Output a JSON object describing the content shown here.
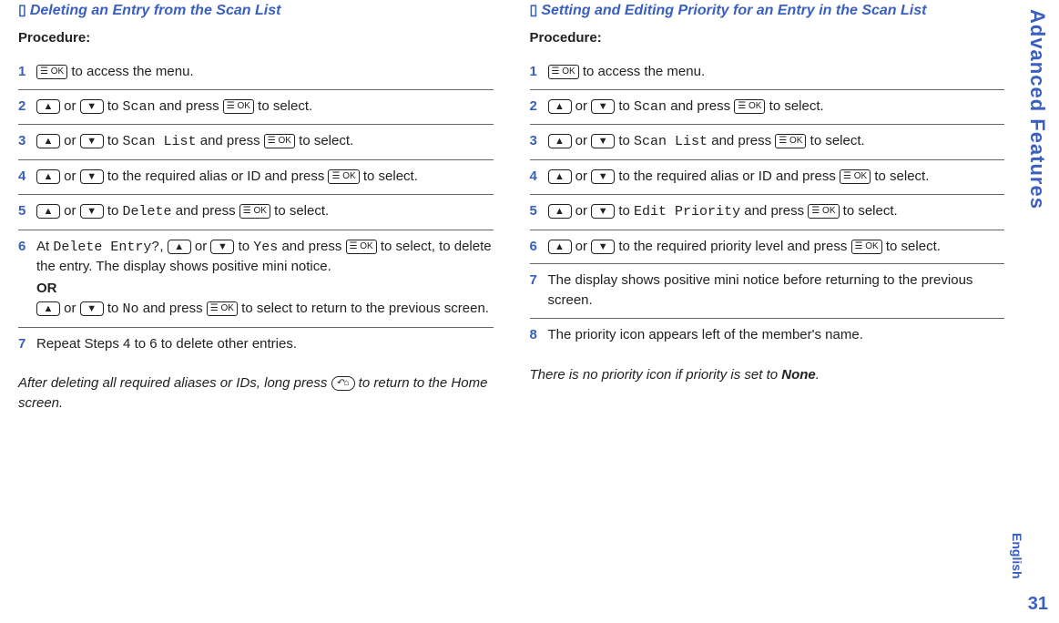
{
  "sideTab": "Advanced Features",
  "langTab": "English",
  "pageNumber": "31",
  "left": {
    "title": "Deleting an Entry from the Scan List",
    "procedureLabel": "Procedure:",
    "steps": {
      "s1": {
        "num": "1",
        "a": " to access the menu."
      },
      "s2": {
        "num": "2",
        "or": " or ",
        "to": " to ",
        "scan": "Scan",
        "press": " and press ",
        "select": " to select."
      },
      "s3": {
        "num": "3",
        "or": " or ",
        "to": " to ",
        "scanlist": "Scan List",
        "press": " and press ",
        "select": " to select."
      },
      "s4": {
        "num": "4",
        "or": " or ",
        "to": " to the required alias or ID and press ",
        "select": " to select."
      },
      "s5": {
        "num": "5",
        "or": " or ",
        "to": " to ",
        "del": "Delete",
        "press": " and press ",
        "select": " to select."
      },
      "s6": {
        "num": "6",
        "atLabel": "At ",
        "delq": "Delete Entry?",
        "comma": ", ",
        "or": " or ",
        "to": " to ",
        "yes": "Yes",
        "press": " and press ",
        "tail": " to select, to delete the entry. The display shows positive mini notice.",
        "orWord": "OR",
        "or2": " or ",
        "to2": " to ",
        "no": "No",
        "press2": " and press ",
        "tail2": " to select to return to the previous screen."
      },
      "s7": {
        "num": "7",
        "text": "Repeat Steps 4 to 6 to delete other entries."
      }
    },
    "footnote": {
      "a": "After deleting all required aliases or IDs, long press ",
      "b": " to return to the Home screen."
    }
  },
  "right": {
    "title": "Setting and Editing Priority for an Entry in the Scan List",
    "procedureLabel": "Procedure:",
    "steps": {
      "s1": {
        "num": "1",
        "a": " to access the menu."
      },
      "s2": {
        "num": "2",
        "or": " or ",
        "to": " to ",
        "scan": "Scan",
        "press": " and press ",
        "select": " to select."
      },
      "s3": {
        "num": "3",
        "or": " or ",
        "to": " to ",
        "scanlist": "Scan List",
        "press": " and press ",
        "select": " to select."
      },
      "s4": {
        "num": "4",
        "or": " or ",
        "to": " to the required alias or ID and press ",
        "select": " to select."
      },
      "s5": {
        "num": "5",
        "or": " or ",
        "to": " to ",
        "edit": "Edit Priority",
        "press": " and press ",
        "select": " to select."
      },
      "s6": {
        "num": "6",
        "or": " or ",
        "to": " to the required priority level and press ",
        "select": " to select."
      },
      "s7": {
        "num": "7",
        "text": "The display shows positive mini notice before returning to the previous screen."
      },
      "s8": {
        "num": "8",
        "text": "The priority icon appears left of the member's name."
      }
    },
    "footnote": {
      "a": "There is no priority icon if priority is set to ",
      "none": "None",
      "dot": "."
    }
  },
  "keys": {
    "ok": "☰ OK",
    "up": "▲",
    "down": "▼",
    "back": "↶⌂"
  }
}
